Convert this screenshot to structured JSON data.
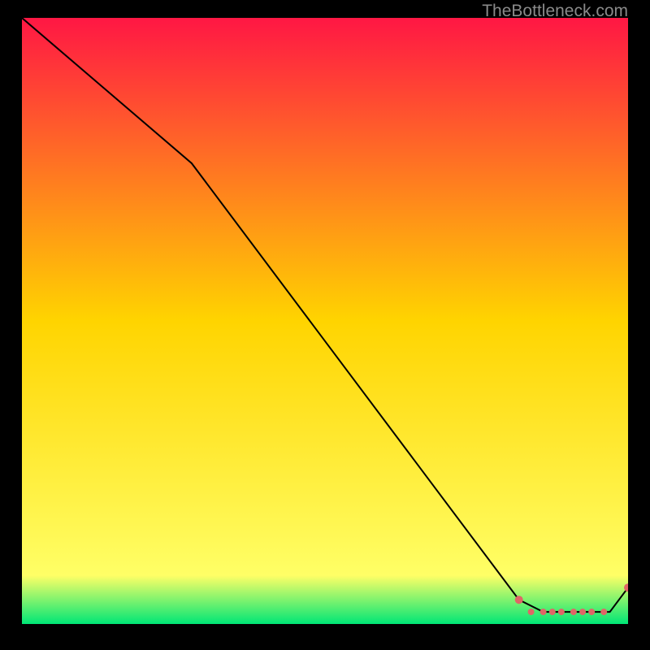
{
  "watermark": "TheBottleneck.com",
  "chart_data": {
    "type": "line",
    "title": "",
    "xlabel": "",
    "ylabel": "",
    "xlim": [
      0,
      100
    ],
    "ylim": [
      0,
      100
    ],
    "grid": false,
    "legend": false,
    "background_gradient": {
      "stops": [
        {
          "pos": 0,
          "color": "#ff1744"
        },
        {
          "pos": 50,
          "color": "#ffd400"
        },
        {
          "pos": 92,
          "color": "#ffff66"
        },
        {
          "pos": 100,
          "color": "#00e676"
        }
      ]
    },
    "series": [
      {
        "name": "curve",
        "color": "#000000",
        "x": [
          0,
          28,
          82,
          86,
          90,
          94,
          97,
          100
        ],
        "values": [
          100,
          76,
          4,
          2,
          2,
          2,
          2,
          6
        ]
      }
    ],
    "markers": {
      "name": "red-dots",
      "color": "#e06666",
      "points": [
        {
          "x": 82,
          "y": 4
        },
        {
          "x": 84,
          "y": 2
        },
        {
          "x": 86,
          "y": 2
        },
        {
          "x": 87.5,
          "y": 2
        },
        {
          "x": 89,
          "y": 2
        },
        {
          "x": 91,
          "y": 2
        },
        {
          "x": 92.5,
          "y": 2
        },
        {
          "x": 94,
          "y": 2
        },
        {
          "x": 96,
          "y": 2
        },
        {
          "x": 100,
          "y": 6
        }
      ]
    }
  }
}
